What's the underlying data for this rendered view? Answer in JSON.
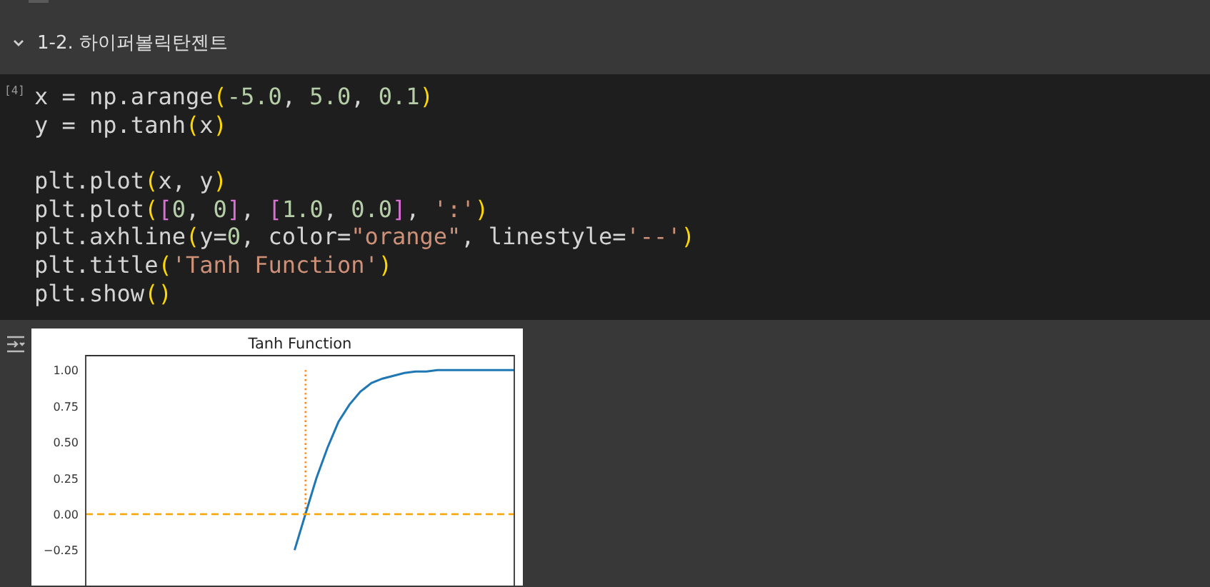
{
  "section": {
    "expanded": true,
    "title": "1-2. 하이퍼볼릭탄젠트"
  },
  "code_cell": {
    "execution_count": "[4]",
    "lines": [
      {
        "tokens": [
          {
            "kind": "plain",
            "text": "x = np.arange"
          },
          {
            "kind": "paren",
            "text": "("
          },
          {
            "kind": "number",
            "text": "-5.0"
          },
          {
            "kind": "plain",
            "text": ", "
          },
          {
            "kind": "number",
            "text": "5.0"
          },
          {
            "kind": "plain",
            "text": ", "
          },
          {
            "kind": "number",
            "text": "0.1"
          },
          {
            "kind": "paren",
            "text": ")"
          }
        ]
      },
      {
        "tokens": [
          {
            "kind": "plain",
            "text": "y = np.tanh"
          },
          {
            "kind": "paren",
            "text": "("
          },
          {
            "kind": "plain",
            "text": "x"
          },
          {
            "kind": "paren",
            "text": ")"
          }
        ]
      },
      {
        "gap_before": true,
        "tokens": [
          {
            "kind": "plain",
            "text": "plt.plot"
          },
          {
            "kind": "paren",
            "text": "("
          },
          {
            "kind": "plain",
            "text": "x, y"
          },
          {
            "kind": "paren",
            "text": ")"
          }
        ]
      },
      {
        "tokens": [
          {
            "kind": "plain",
            "text": "plt.plot"
          },
          {
            "kind": "paren",
            "text": "("
          },
          {
            "kind": "bracket",
            "text": "["
          },
          {
            "kind": "number",
            "text": "0"
          },
          {
            "kind": "plain",
            "text": ", "
          },
          {
            "kind": "number",
            "text": "0"
          },
          {
            "kind": "bracket",
            "text": "]"
          },
          {
            "kind": "plain",
            "text": ", "
          },
          {
            "kind": "bracket",
            "text": "["
          },
          {
            "kind": "number",
            "text": "1.0"
          },
          {
            "kind": "plain",
            "text": ", "
          },
          {
            "kind": "number",
            "text": "0.0"
          },
          {
            "kind": "bracket",
            "text": "]"
          },
          {
            "kind": "plain",
            "text": ", "
          },
          {
            "kind": "string",
            "text": "':'"
          },
          {
            "kind": "paren",
            "text": ")"
          }
        ]
      },
      {
        "tokens": [
          {
            "kind": "plain",
            "text": "plt.axhline"
          },
          {
            "kind": "paren",
            "text": "("
          },
          {
            "kind": "plain",
            "text": "y="
          },
          {
            "kind": "number",
            "text": "0"
          },
          {
            "kind": "plain",
            "text": ", color="
          },
          {
            "kind": "string",
            "text": "\"orange\""
          },
          {
            "kind": "plain",
            "text": ", linestyle="
          },
          {
            "kind": "string",
            "text": "'--'"
          },
          {
            "kind": "paren",
            "text": ")"
          }
        ]
      },
      {
        "tokens": [
          {
            "kind": "plain",
            "text": "plt.title"
          },
          {
            "kind": "paren",
            "text": "("
          },
          {
            "kind": "string",
            "text": "'Tanh Function'"
          },
          {
            "kind": "paren",
            "text": ")"
          }
        ]
      },
      {
        "tokens": [
          {
            "kind": "plain",
            "text": "plt.show"
          },
          {
            "kind": "paren",
            "text": "()"
          }
        ]
      }
    ]
  },
  "output": {
    "chart_data": {
      "type": "line",
      "title": "Tanh Function",
      "ylim": [
        -1.1,
        1.1
      ],
      "yticks": [
        {
          "value": 1.0,
          "label": "1.00"
        },
        {
          "value": 0.75,
          "label": "0.75"
        },
        {
          "value": 0.5,
          "label": "0.50"
        },
        {
          "value": 0.25,
          "label": "0.25"
        },
        {
          "value": 0.0,
          "label": "0.00"
        },
        {
          "value": -0.25,
          "label": "−0.25"
        }
      ],
      "categories": [
        null,
        null,
        null,
        null,
        null,
        null,
        null,
        null,
        null,
        null,
        null,
        null,
        null,
        null,
        null,
        null,
        null,
        null,
        null,
        null,
        null,
        null,
        null,
        null,
        null,
        null,
        null,
        null,
        null,
        null,
        null,
        null,
        null,
        null,
        null,
        null,
        null,
        null,
        null,
        null
      ],
      "series": [
        {
          "color": "#1f77b4",
          "line_style": "solid",
          "values": [
            null,
            null,
            null,
            null,
            null,
            null,
            null,
            null,
            null,
            null,
            null,
            null,
            null,
            null,
            null,
            null,
            null,
            null,
            null,
            -0.25,
            0,
            0.25,
            0.46,
            0.64,
            0.76,
            0.85,
            0.91,
            0.94,
            0.96,
            0.98,
            0.99,
            0.99,
            1.0,
            1.0,
            1.0,
            1.0,
            1.0,
            1.0,
            1.0,
            1.0
          ]
        },
        {
          "color": "#ffa500",
          "line_style": "dashed",
          "values": [
            0,
            0,
            0,
            0,
            0,
            0,
            0,
            0,
            0,
            0,
            0,
            0,
            0,
            0,
            0,
            0,
            0,
            0,
            0,
            0,
            0,
            0,
            0,
            0,
            0,
            0,
            0,
            0,
            0,
            0,
            0,
            0,
            0,
            0,
            0,
            0,
            0,
            0,
            0,
            0
          ]
        }
      ]
    }
  }
}
